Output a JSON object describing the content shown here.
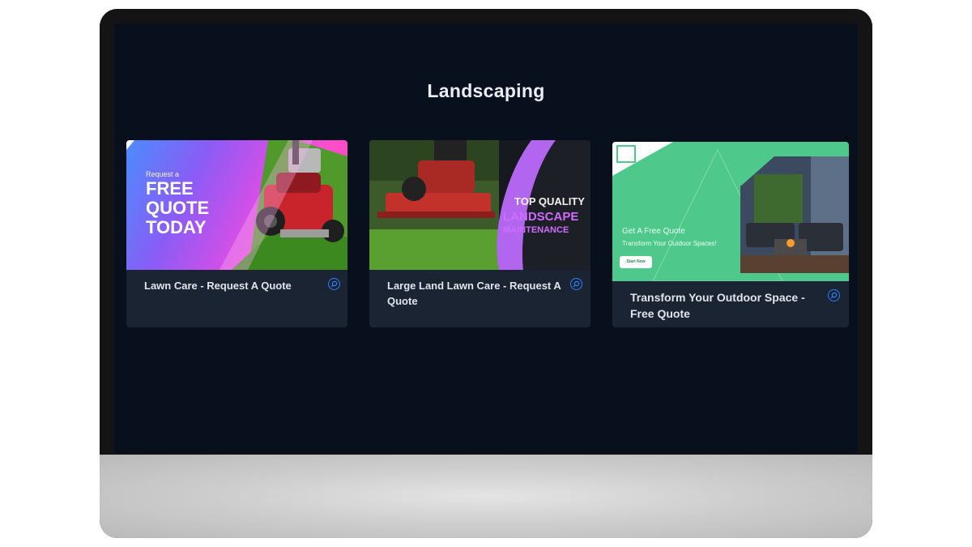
{
  "page": {
    "title": "Landscaping"
  },
  "cards": [
    {
      "caption": "Lawn Care - Request A Quote",
      "thumb": {
        "small": "Request a",
        "lines": [
          "FREE",
          "QUOTE",
          "TODAY"
        ]
      }
    },
    {
      "caption": "Large Land Lawn Care - Request A Quote",
      "thumb": {
        "line1": "TOP QUALITY",
        "line2": "LANDSCAPE",
        "line3": "MAINTENANCE"
      }
    },
    {
      "caption": "Transform Your Outdoor Space - Free Quote",
      "thumb": {
        "heading": "Get A Free Quote",
        "sub": "Transform Your Outdoor Spaces!",
        "button": "Start Now"
      }
    }
  ],
  "icons": {
    "zoom": "magnifier-icon"
  },
  "colors": {
    "screen_bg": "#07101c",
    "card_bg": "#1a2432",
    "accent": "#2d7dff"
  }
}
